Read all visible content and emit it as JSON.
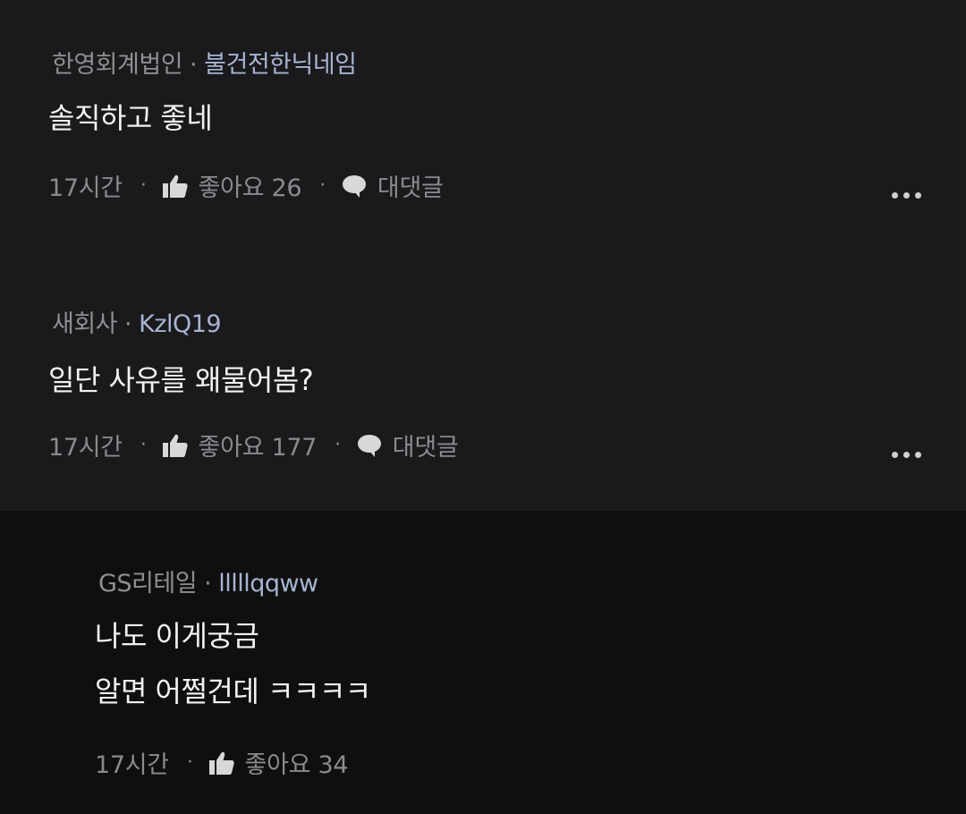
{
  "comments": [
    {
      "company": "한영회계법인",
      "separator": "·",
      "nickname": "불건전한닉네임",
      "lines": [
        "솔직하고 좋네"
      ],
      "time": "17시간",
      "like_label": "좋아요 26",
      "reply_label": "대댓글"
    },
    {
      "company": "새회사",
      "separator": "·",
      "nickname": "KzlQ19",
      "lines": [
        "일단 사유를 왜물어봄?"
      ],
      "time": "17시간",
      "like_label": "좋아요 177",
      "reply_label": "대댓글"
    },
    {
      "company": "GS리테일",
      "separator": "·",
      "nickname": "lllllqqww",
      "lines": [
        "나도 이게궁금",
        "알면 어쩔건데 ㅋㅋㅋㅋ"
      ],
      "time": "17시간",
      "like_label": "좋아요 34"
    }
  ],
  "action_separator": "·",
  "icons": {
    "like": "thumbs-up-icon",
    "reply": "speech-bubble-icon",
    "more": "more-dots-icon"
  },
  "colors": {
    "background": "#1a1a1c",
    "reply_background": "#0f0f10",
    "nickname": "#a7b4d2",
    "meta": "#8f8f93",
    "body": "#f2f2f2"
  }
}
